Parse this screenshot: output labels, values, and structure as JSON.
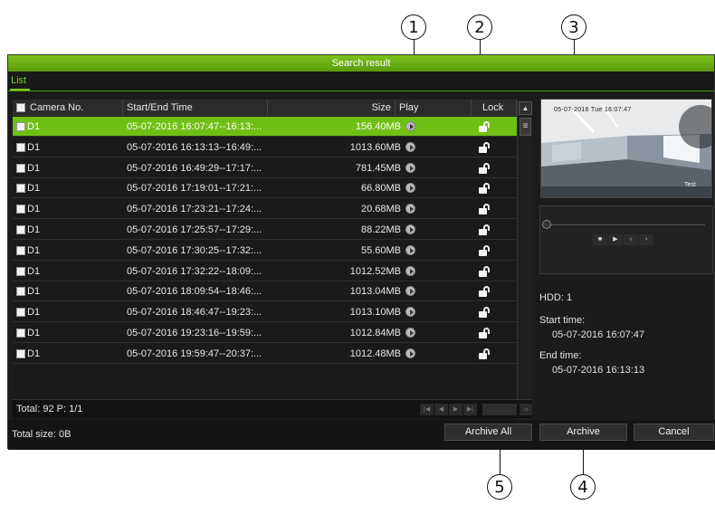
{
  "callouts": [
    "1",
    "2",
    "3",
    "4",
    "5"
  ],
  "window": {
    "title": "Search result",
    "tab": "List"
  },
  "table": {
    "headers": [
      "Camera No.",
      "Start/End Time",
      "Size",
      "Play",
      "Lock"
    ],
    "rows": [
      {
        "camera": "D1",
        "time": "05-07-2016 16:07:47--16:13:...",
        "size": "156.40MB",
        "selected": true
      },
      {
        "camera": "D1",
        "time": "05-07-2016 16:13:13--16:49:...",
        "size": "1013.60MB",
        "selected": false
      },
      {
        "camera": "D1",
        "time": "05-07-2016 16:49:29--17:17:...",
        "size": "781.45MB",
        "selected": false
      },
      {
        "camera": "D1",
        "time": "05-07-2016 17:19:01--17:21:...",
        "size": "66.80MB",
        "selected": false
      },
      {
        "camera": "D1",
        "time": "05-07-2016 17:23:21--17:24:...",
        "size": "20.68MB",
        "selected": false
      },
      {
        "camera": "D1",
        "time": "05-07-2016 17:25:57--17:29:...",
        "size": "88.22MB",
        "selected": false
      },
      {
        "camera": "D1",
        "time": "05-07-2016 17:30:25--17:32:...",
        "size": "55.60MB",
        "selected": false
      },
      {
        "camera": "D1",
        "time": "05-07-2016 17:32:22--18:09:...",
        "size": "1012.52MB",
        "selected": false
      },
      {
        "camera": "D1",
        "time": "05-07-2016 18:09:54--18:46:...",
        "size": "1013.04MB",
        "selected": false
      },
      {
        "camera": "D1",
        "time": "05-07-2016 18:46:47--19:23:...",
        "size": "1013.10MB",
        "selected": false
      },
      {
        "camera": "D1",
        "time": "05-07-2016 19:23:16--19:59:...",
        "size": "1012.84MB",
        "selected": false
      },
      {
        "camera": "D1",
        "time": "05-07-2016 19:59:47--20:37:...",
        "size": "1012.48MB",
        "selected": false
      }
    ]
  },
  "footer": {
    "total": "Total: 92  P: 1/1",
    "total_size": "Total size: 0B"
  },
  "buttons": {
    "archive_all": "Archive All",
    "archive": "Archive",
    "cancel": "Cancel"
  },
  "preview": {
    "timestamp": "05-07-2016 Tue 16:07:47",
    "camera_label": "Test"
  },
  "info": {
    "hdd": "HDD: 1",
    "start_label": "Start time:",
    "start_value": "05-07-2016 16:07:47",
    "end_label": "End time:",
    "end_value": "05-07-2016 16:13:13"
  },
  "icons": {
    "play": "play-circle-icon",
    "lock": "unlocked-padlock-icon"
  },
  "colors": {
    "accent": "#6fc014",
    "titlebar": "#7cc21d"
  }
}
